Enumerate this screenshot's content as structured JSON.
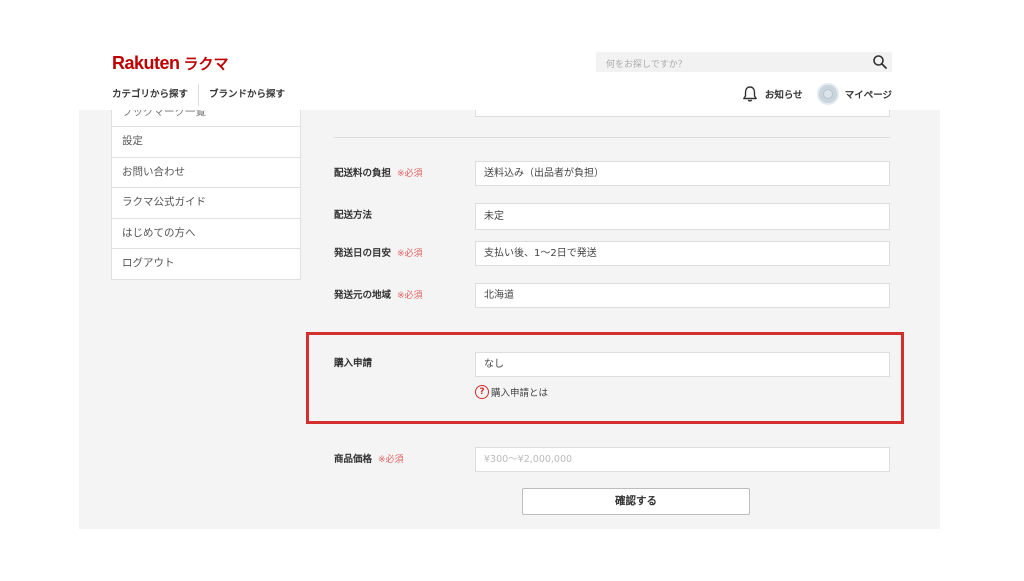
{
  "header": {
    "logo_rakuten": "Rakuten",
    "logo_rakuma": "ラクマ",
    "search_placeholder": "何をお探しですか？",
    "nav": [
      "カテゴリから探す",
      "ブランドから探す"
    ],
    "notifications_label": "お知らせ",
    "mypage_label": "マイページ"
  },
  "sidebar": {
    "cut_item": "ブックマーク一覧",
    "items": [
      "設定",
      "お問い合わせ",
      "ラクマ公式ガイド",
      "はじめての方へ",
      "ログアウト"
    ]
  },
  "form": {
    "required_mark": "※必須",
    "shipping_fee": {
      "label": "配送料の負担",
      "value": "送料込み（出品者が負担）"
    },
    "shipping_method": {
      "label": "配送方法",
      "value": "未定"
    },
    "ship_days": {
      "label": "発送日の目安",
      "value": "支払い後、1〜2日で発送"
    },
    "ship_region": {
      "label": "発送元の地域",
      "value": "北海道"
    },
    "purchase_request": {
      "label": "購入申請",
      "value": "なし",
      "help_text": "購入申請とは",
      "help_icon_glyph": "?"
    },
    "price": {
      "label": "商品価格",
      "placeholder": "¥300〜¥2,000,000"
    },
    "confirm_label": "確認する"
  },
  "colors": {
    "brand": "#bf0000",
    "highlight": "#d32f2f",
    "required": "#e06060"
  }
}
